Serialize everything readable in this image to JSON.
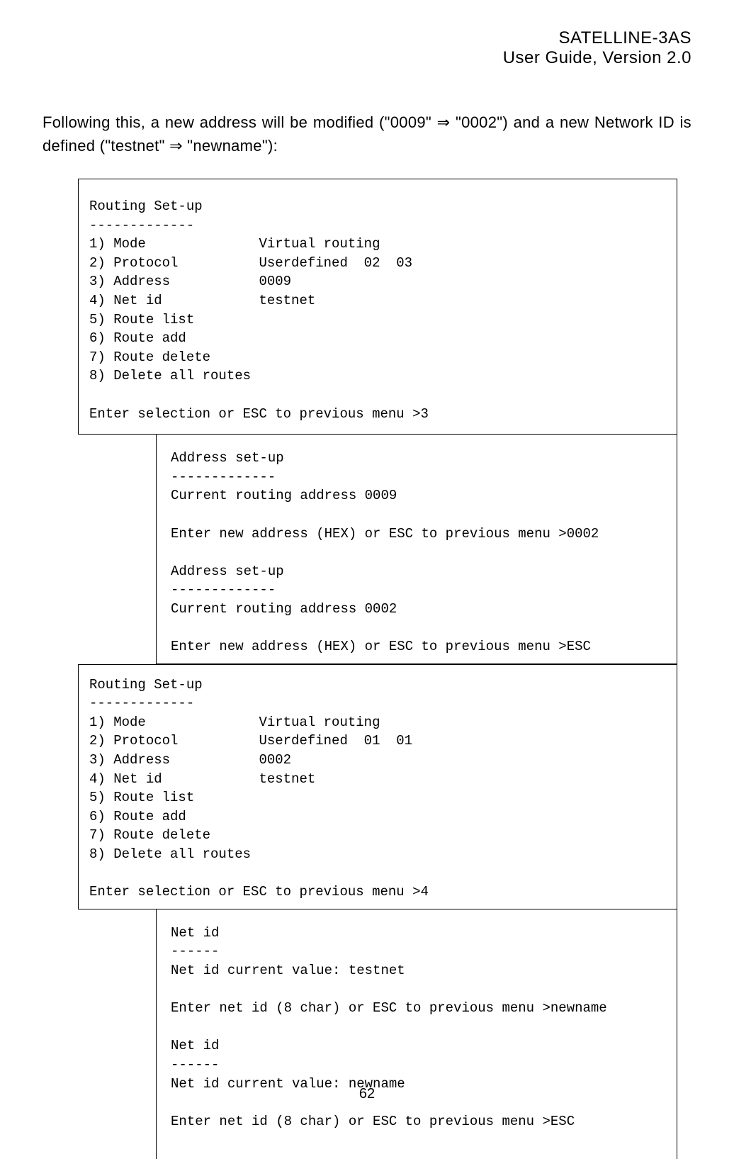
{
  "header": {
    "line1": "SATELLINE-3AS",
    "line2": "User Guide, Version 2.0"
  },
  "intro": {
    "part1": "Following this, a new address will be modified (\"0009\" ",
    "arrow1": "⇒",
    "part2": " \"0002\") and a new Network ID is defined (\"testnet\" ",
    "arrow2": "⇒",
    "part3": " \"newname\"):"
  },
  "box1": "Routing Set-up\n-------------\n1) Mode              Virtual routing\n2) Protocol          Userdefined  02  03\n3) Address           0009\n4) Net id            testnet\n5) Route list\n6) Route add\n7) Route delete\n8) Delete all routes\n\nEnter selection or ESC to previous menu >3",
  "box2": "Address set-up\n-------------\nCurrent routing address 0009\n\nEnter new address (HEX) or ESC to previous menu >0002\n\nAddress set-up\n-------------\nCurrent routing address 0002\n\nEnter new address (HEX) or ESC to previous menu >ESC",
  "box3": "Routing Set-up\n-------------\n1) Mode              Virtual routing\n2) Protocol          Userdefined  01  01\n3) Address           0002\n4) Net id            testnet\n5) Route list\n6) Route add\n7) Route delete\n8) Delete all routes\n\nEnter selection or ESC to previous menu >4",
  "box4": "Net id\n------\nNet id current value: testnet\n\nEnter net id (8 char) or ESC to previous menu >newname\n\nNet id\n------\nNet id current value: newname\n\nEnter net id (8 char) or ESC to previous menu >ESC",
  "pageNumber": "62"
}
